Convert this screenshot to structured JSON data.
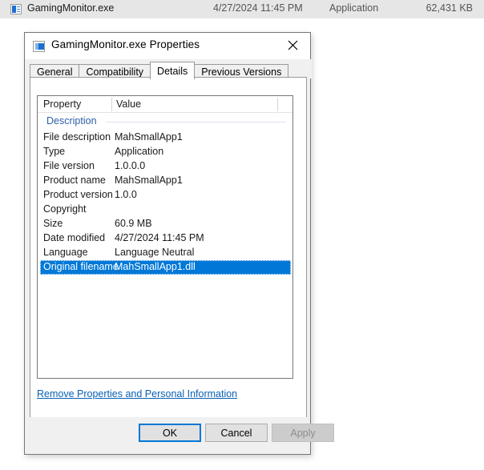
{
  "explorer_row": {
    "icon": "application-file-icon",
    "name": "GamingMonitor.exe",
    "date_modified": "4/27/2024 11:45 PM",
    "type": "Application",
    "size": "62,431 KB"
  },
  "dialog": {
    "icon": "application-icon",
    "title": "GamingMonitor.exe Properties",
    "close_label": "✕",
    "tabs": [
      {
        "label": "General",
        "active": false
      },
      {
        "label": "Compatibility",
        "active": false
      },
      {
        "label": "Details",
        "active": true
      },
      {
        "label": "Previous Versions",
        "active": false
      }
    ],
    "details": {
      "columns": {
        "property": "Property",
        "value": "Value"
      },
      "group_label": "Description",
      "rows": [
        {
          "property": "File description",
          "value": "MahSmallApp1",
          "selected": false
        },
        {
          "property": "Type",
          "value": "Application",
          "selected": false
        },
        {
          "property": "File version",
          "value": "1.0.0.0",
          "selected": false
        },
        {
          "property": "Product name",
          "value": "MahSmallApp1",
          "selected": false
        },
        {
          "property": "Product version",
          "value": "1.0.0",
          "selected": false
        },
        {
          "property": "Copyright",
          "value": "",
          "selected": false
        },
        {
          "property": "Size",
          "value": "60.9 MB",
          "selected": false
        },
        {
          "property": "Date modified",
          "value": "4/27/2024 11:45 PM",
          "selected": false
        },
        {
          "property": "Language",
          "value": "Language Neutral",
          "selected": false
        },
        {
          "property": "Original filename",
          "value": "MahSmallApp1.dll",
          "selected": true
        }
      ]
    },
    "remove_link": "Remove Properties and Personal Information",
    "buttons": {
      "ok": "OK",
      "cancel": "Cancel",
      "apply": "Apply",
      "apply_disabled": true
    }
  },
  "colors": {
    "accent": "#0078d7",
    "selection": "#0078d7",
    "link": "#0a5fb5",
    "group_header": "#2b5fa8",
    "dialog_bg": "#f0f0f0",
    "explorer_row_bg": "#e6e6e6"
  }
}
